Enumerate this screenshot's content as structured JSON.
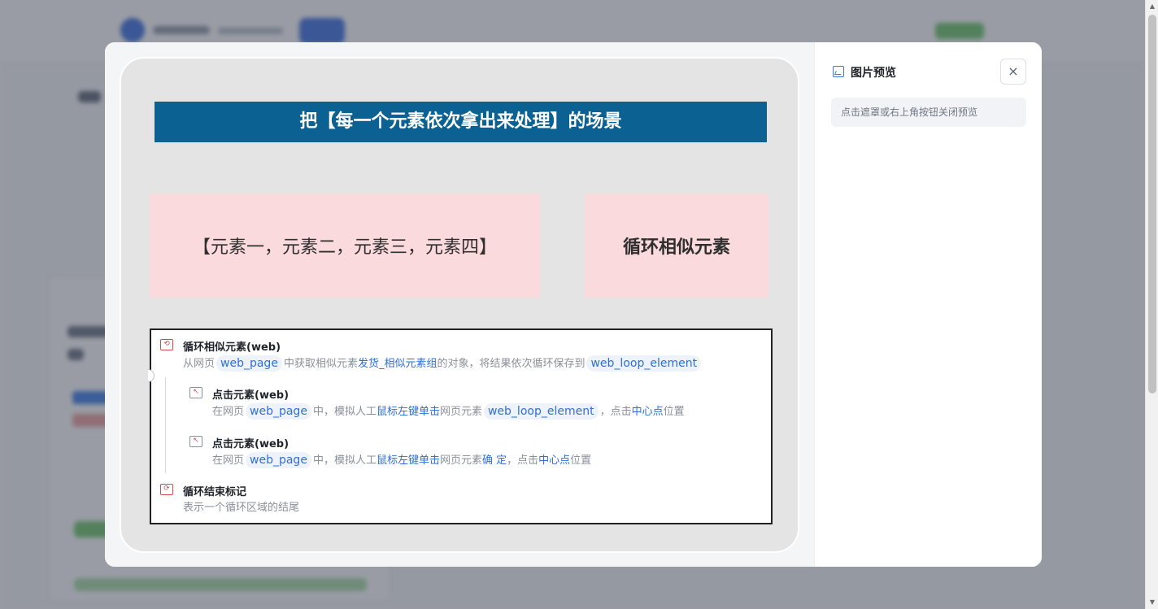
{
  "preview_panel": {
    "title": "图片预览",
    "close_symbol": "×",
    "hint": "点击遮罩或右上角按钮关闭预览"
  },
  "image": {
    "heading": "把【每一个元素依次拿出来处理】的场景",
    "left_box": "【元素一，元素二，元素三，元素四】",
    "right_box": "循环相似元素",
    "flow": {
      "loop": {
        "title": "循环相似元素(web)",
        "desc_pre": "从网页",
        "page_var": "web_page",
        "desc_mid": "中获取相似元素",
        "group_name": "发货_相似元素组",
        "desc_post": "的对象，将结果依次循环保存到",
        "loop_var": "web_loop_element"
      },
      "click1": {
        "title": "点击元素(web)",
        "desc_pre": "在网页",
        "page_var": "web_page",
        "desc_mid": "中，模拟人工",
        "action": "鼠标左键单击",
        "desc_mid2": "网页元素",
        "target_var": "web_loop_element",
        "desc_mid3": "，点击",
        "position": "中心点",
        "desc_post": "位置"
      },
      "click2": {
        "title": "点击元素(web)",
        "desc_pre": "在网页",
        "page_var": "web_page",
        "desc_mid": "中，模拟人工",
        "action": "鼠标左键单击",
        "desc_mid2": "网页元素",
        "target": "确 定",
        "desc_mid3": "，点击",
        "position": "中心点",
        "desc_post": "位置"
      },
      "end": {
        "title": "循环结束标记",
        "desc": "表示一个循环区域的结尾"
      }
    }
  },
  "colors": {
    "heading_bg": "#0c6193",
    "box_bg": "#fadadd",
    "accent": "#2f6fd6"
  },
  "icons": {
    "loop": "loop-icon",
    "click": "click-icon",
    "end": "loop-end-icon",
    "image": "image-icon",
    "close": "close-icon"
  }
}
